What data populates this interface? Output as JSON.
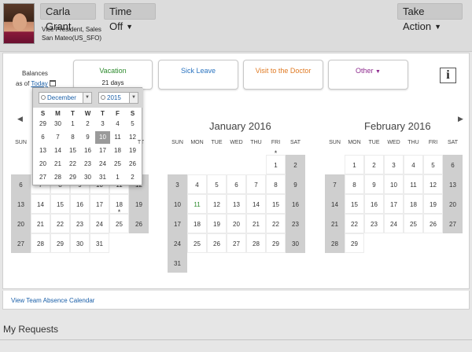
{
  "header": {
    "user_name": "Carla Grant",
    "menu_label": "Time Off",
    "take_action_label": "Take Action",
    "title_line": "Vice President, Sales",
    "location_line": "San Mateo(US_SFO)"
  },
  "balances": {
    "label": "Balances",
    "as_of_prefix": "as of",
    "as_of_link": "Today"
  },
  "leave_types": [
    {
      "label": "Vacation",
      "days": "21 days",
      "color": "#2e8b2e"
    },
    {
      "label": "Sick Leave",
      "days": "",
      "color": "#2a74c0"
    },
    {
      "label": "Visit to the Doctor",
      "days": "",
      "color": "#e07b24"
    },
    {
      "label": "Other",
      "days": "",
      "color": "#8e2b8e"
    }
  ],
  "info_label": "i",
  "dow_labels": [
    "SUN",
    "MON",
    "TUE",
    "WED",
    "THU",
    "FRI",
    "SAT"
  ],
  "calendars": [
    {
      "title": "",
      "rows": [
        [
          "6",
          "7",
          "8",
          "9",
          "10",
          "11",
          "12"
        ],
        [
          "13",
          "14",
          "15",
          "16",
          "17",
          "18",
          "19"
        ],
        [
          "20",
          "21",
          "22",
          "23",
          "24",
          "25",
          "26"
        ],
        [
          "27",
          "28",
          "29",
          "30",
          "31",
          "",
          ""
        ]
      ],
      "star_days": [
        "25"
      ]
    },
    {
      "title": "January 2016",
      "rows": [
        [
          "",
          "",
          "",
          "",
          "",
          "1",
          "2"
        ],
        [
          "3",
          "4",
          "5",
          "6",
          "7",
          "8",
          "9"
        ],
        [
          "10",
          "11",
          "12",
          "13",
          "14",
          "15",
          "16"
        ],
        [
          "17",
          "18",
          "19",
          "20",
          "21",
          "22",
          "23"
        ],
        [
          "24",
          "25",
          "26",
          "27",
          "28",
          "29",
          "30"
        ],
        [
          "31",
          "",
          "",
          "",
          "",
          "",
          ""
        ]
      ],
      "star_days": [
        "1"
      ],
      "green_days": [
        "11"
      ]
    },
    {
      "title": "February 2016",
      "rows": [
        [
          "",
          "1",
          "2",
          "3",
          "4",
          "5",
          "6"
        ],
        [
          "7",
          "8",
          "9",
          "10",
          "11",
          "12",
          "13"
        ],
        [
          "14",
          "15",
          "16",
          "17",
          "18",
          "19",
          "20"
        ],
        [
          "21",
          "22",
          "23",
          "24",
          "25",
          "26",
          "27"
        ],
        [
          "28",
          "29",
          "",
          "",
          "",
          "",
          ""
        ]
      ],
      "star_days": []
    }
  ],
  "picker": {
    "month": "December",
    "year": "2015",
    "dow_labels": [
      "S",
      "M",
      "T",
      "W",
      "T",
      "F",
      "S"
    ],
    "rows": [
      [
        "29",
        "30",
        "1",
        "2",
        "3",
        "4",
        "5"
      ],
      [
        "6",
        "7",
        "8",
        "9",
        "10",
        "11",
        "12"
      ],
      [
        "13",
        "14",
        "15",
        "16",
        "17",
        "18",
        "19"
      ],
      [
        "20",
        "21",
        "22",
        "23",
        "24",
        "25",
        "26"
      ],
      [
        "27",
        "28",
        "29",
        "30",
        "31",
        "1",
        "2"
      ]
    ],
    "selected": "10",
    "hint_dow": "T"
  },
  "team_link": "View Team Absence Calendar",
  "my_requests": "My Requests",
  "nav": {
    "prev": "◀",
    "next": "▶"
  }
}
